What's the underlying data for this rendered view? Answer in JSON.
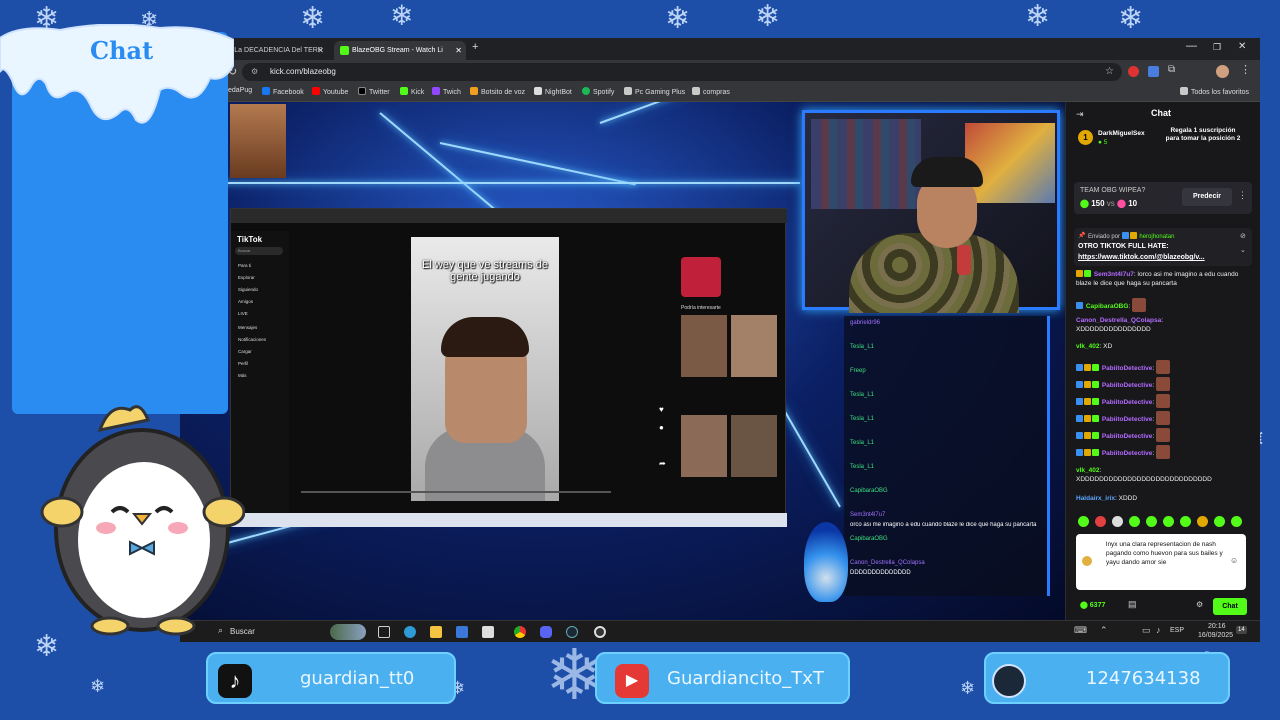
{
  "overlay": {
    "chat_title": "Chat",
    "socials": [
      {
        "icon": "tiktok-icon",
        "handle": "guardian_tt0"
      },
      {
        "icon": "youtube-icon",
        "handle": "Guardiancito_TxT"
      },
      {
        "icon": "steam-icon",
        "handle": "1247634138"
      }
    ]
  },
  "browser": {
    "tabs": [
      {
        "label": "(561) La DECADENCIA Del TERR",
        "active": false
      },
      {
        "label": "BlazeOBG Stream - Watch Li",
        "active": true
      }
    ],
    "url": "kick.com/blazeobg",
    "bookmarks": [
      "edaPug",
      "Facebook",
      "Youtube",
      "Twitter",
      "Kick",
      "Twich",
      "Botsito de voz",
      "NightBot",
      "Spotify",
      "Pc Gaming Plus",
      "compras"
    ],
    "all_favorites": "Todos los favoritos"
  },
  "stream": {
    "tiktok_logo": "TikTok",
    "tiktok_search": "Buscar",
    "tiktok_nav": [
      "Para ti",
      "Explorar",
      "Siguiendo",
      "Amigos",
      "LIVE",
      "Mensajes",
      "Notificaciones",
      "Cargar",
      "Perfil",
      "Más"
    ],
    "tiktok_caption": "El wey que ve streams de gente jugando",
    "tiktok_right_header": "Podría interesarte",
    "stream_chat_lines": [
      {
        "user": "gabrieldr96",
        "text": ""
      },
      {
        "user": "Tesla_L1",
        "text": ""
      },
      {
        "user": "Freep",
        "text": ""
      },
      {
        "user": "Tesla_L1",
        "text": ""
      },
      {
        "user": "Tesla_L1",
        "text": ""
      },
      {
        "user": "Tesla_L1",
        "text": ""
      },
      {
        "user": "Tesla_L1",
        "text": ""
      },
      {
        "user": "CapibaraOBG",
        "text": ""
      },
      {
        "user": "Sem3nt4l7u7",
        "text": ""
      },
      {
        "user": "",
        "text": "orco asi me imagino a edu cuando blaze le dice que haga su pancarta"
      },
      {
        "user": "CapibaraOBG",
        "text": ""
      },
      {
        "user": "Canon_Destrella_QColapsa",
        "text": ""
      },
      {
        "user": "",
        "text": "DDDDDDDDDDDDDD"
      }
    ]
  },
  "kick_chat": {
    "header": "Chat",
    "top_gifter": {
      "name": "DarkMiguelSex",
      "count": "5",
      "rank": "1"
    },
    "gift_cta": "Regala 1 suscripción para tomar la posición 2",
    "prediction": {
      "question": "TEAM OBG WIPEA?",
      "left_value": "150",
      "vs": "vs",
      "right_value": "10",
      "button": "Predecir"
    },
    "pinned": {
      "sent_by": "Enviado por",
      "user": "herojhonatan",
      "text": "OTRO TIKTOK FULL HATE:",
      "link": "https://www.tiktok.com/@blazeobg/v..."
    },
    "messages": [
      {
        "user": "Sem3nt4l7u7",
        "color": "kn",
        "text": "lorco asi me imagino a edu cuando blaze le dice que haga su pancarta"
      },
      {
        "user": "CapibaraOBG",
        "color": "kn",
        "text": ""
      },
      {
        "user": "Canon_Destrella_QColapsa",
        "color": "kp",
        "text": "XDDDDDDDDDDDDDDD"
      },
      {
        "user": "vlk_402",
        "color": "kn",
        "text": "XD"
      },
      {
        "user": "PabiitoDetective",
        "color": "kp",
        "text": ""
      },
      {
        "user": "PabiitoDetective",
        "color": "kp",
        "text": ""
      },
      {
        "user": "PabiitoDetective",
        "color": "kp",
        "text": ""
      },
      {
        "user": "PabiitoDetective",
        "color": "kp",
        "text": ""
      },
      {
        "user": "PabiitoDetective",
        "color": "kp",
        "text": ""
      },
      {
        "user": "PabiitoDetective",
        "color": "kp",
        "text": ""
      },
      {
        "user": "vlk_402",
        "color": "kn",
        "text": "XDDDDDDDDDDDDDDDDDDDDDDDDDDDD"
      },
      {
        "user": "Haldairx_irix",
        "color": "kv",
        "text": "XDDD"
      }
    ],
    "input_text": "lnyx una clara representacion de nash pagando como huevon para sus bailes y yayu dando amor sie",
    "points": "6377",
    "send_button": "Chat"
  },
  "taskbar": {
    "search": "Buscar",
    "lang": "ESP",
    "time": "20:16",
    "date": "16/09/2025",
    "notif": "14"
  }
}
